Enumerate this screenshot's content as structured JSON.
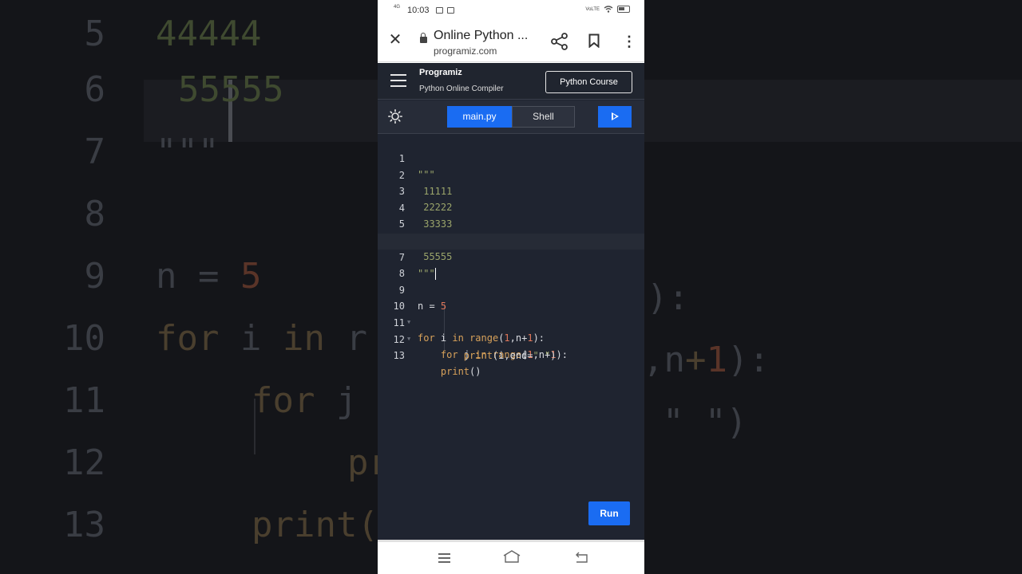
{
  "background_zoom": {
    "lines": [
      {
        "num": "6",
        "code": "55555"
      },
      {
        "num": "7",
        "code": "\"\"\""
      },
      {
        "num": "8",
        "code": ""
      },
      {
        "num": "9",
        "code": "n = 5"
      },
      {
        "num": "10",
        "code": "for i in range(1,n+1):"
      },
      {
        "num": "11",
        "code": "    for j in range(1,n+1):"
      },
      {
        "num": "12",
        "code": "        print(i,end=\" \")"
      },
      {
        "num": "13",
        "code": "    print()"
      }
    ]
  },
  "status_bar": {
    "network": "4G",
    "time": "10:03",
    "right": "VoLTE"
  },
  "browser": {
    "title": "Online Python ...",
    "domain": "programiz.com"
  },
  "app": {
    "brand": "Programiz",
    "subtitle": "Python Online Compiler",
    "course_button": "Python Course",
    "tabs": [
      {
        "label": "main.py",
        "active": true
      },
      {
        "label": "Shell",
        "active": false
      }
    ],
    "run_label": "Run"
  },
  "editor": {
    "active_line": 7,
    "lines": [
      {
        "num": "1",
        "code": "\"\"\""
      },
      {
        "num": "2",
        "code": " 11111"
      },
      {
        "num": "3",
        "code": " 22222"
      },
      {
        "num": "4",
        "code": " 33333"
      },
      {
        "num": "5",
        "code": " 44444"
      },
      {
        "num": "6",
        "code": " 55555"
      },
      {
        "num": "7",
        "code": "\"\"\""
      },
      {
        "num": "8",
        "code": ""
      },
      {
        "num": "9",
        "code": "n = 5"
      },
      {
        "num": "10",
        "code": "for i in range(1,n+1):"
      },
      {
        "num": "11",
        "code": "    for j in range(1,n+1):"
      },
      {
        "num": "12",
        "code": "        print(i,end=\" \")"
      },
      {
        "num": "13",
        "code": "    print()"
      }
    ]
  },
  "colors": {
    "accent": "#1a6cf2",
    "editor_bg": "#1f2430",
    "string": "#9aa46a",
    "keyword": "#d7a15a",
    "number": "#e0775a"
  }
}
